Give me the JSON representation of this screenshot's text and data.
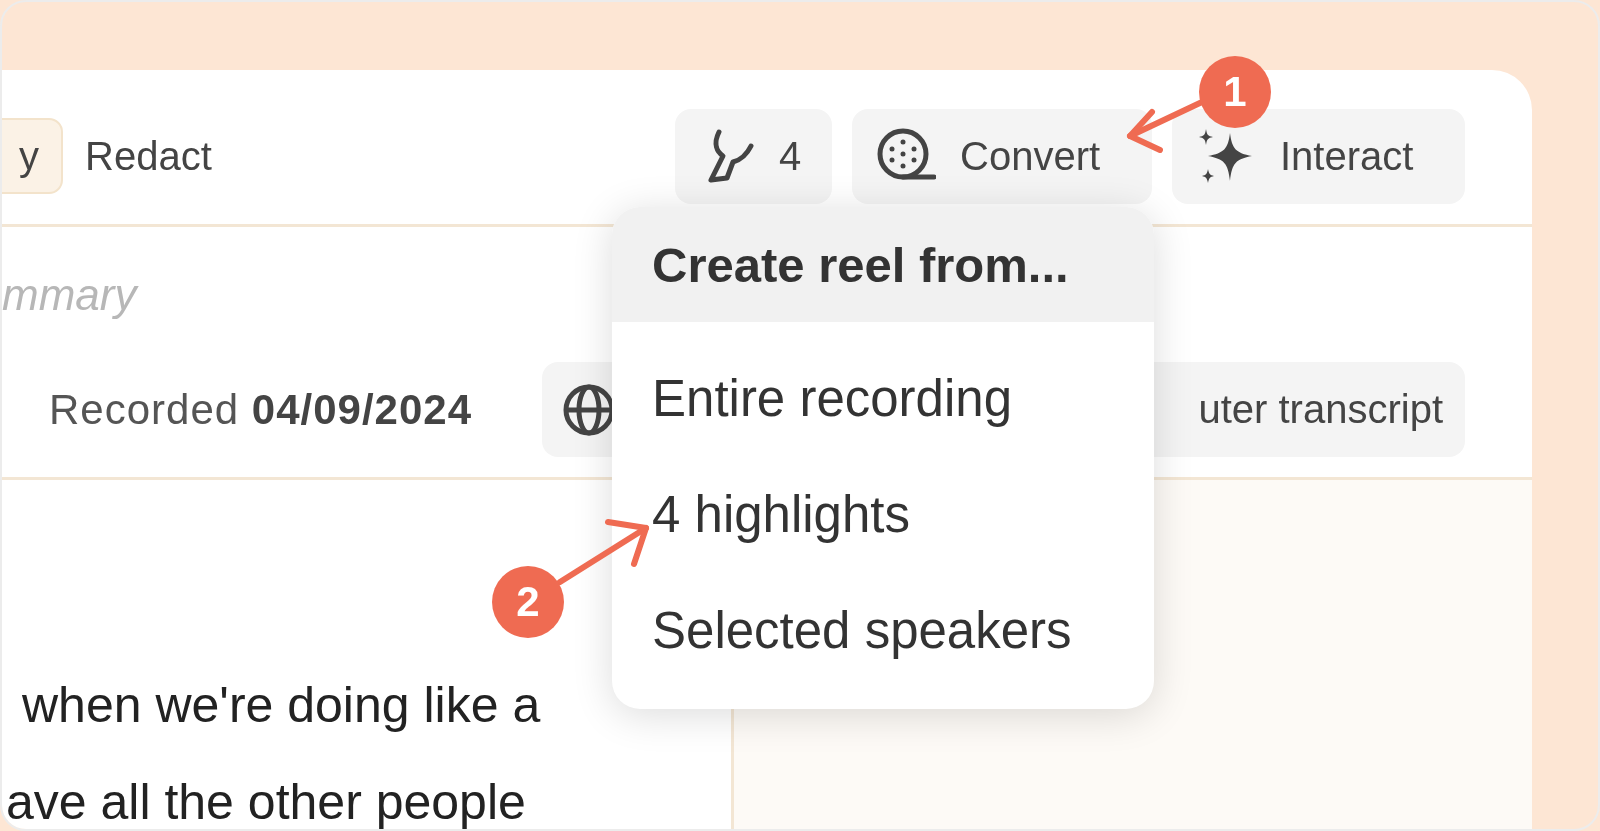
{
  "toolbar": {
    "cut_chip": "y",
    "redact": "Redact",
    "buttons": [
      {
        "kind": "highlights",
        "label": "4"
      },
      {
        "kind": "convert",
        "label": "Convert"
      },
      {
        "kind": "interact",
        "label": "Interact"
      }
    ]
  },
  "summary_label": "mmary",
  "recorded": "Recorded **04/09/2024**",
  "transcript_button": "uter transcript",
  "dropdown": {
    "title": "Create reel from...",
    "items": [
      "Entire recording",
      "4 highlights",
      "Selected speakers"
    ]
  },
  "transcript_lines": [
    "when we're doing like a",
    "ave all the other people"
  ],
  "annotations": [
    {
      "number": "1"
    },
    {
      "number": "2"
    }
  ]
}
